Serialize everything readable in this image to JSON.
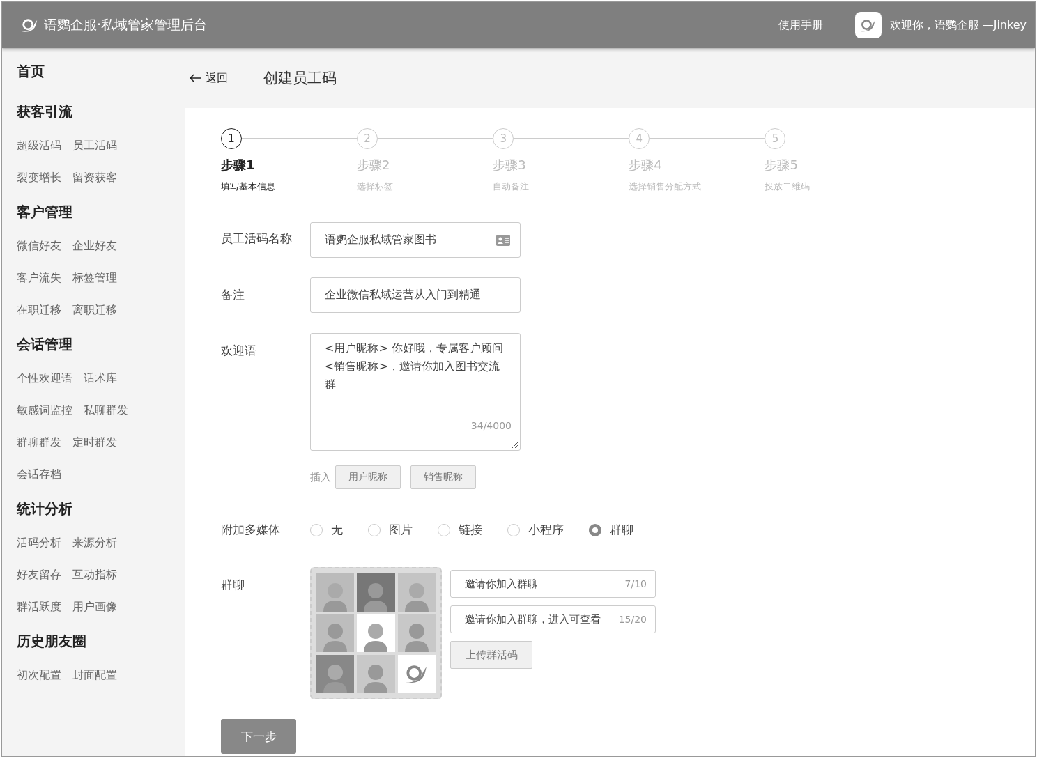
{
  "header": {
    "title": "语鹦企服·私域管家管理后台",
    "manual_link": "使用手册",
    "welcome": "欢迎你，语鹦企服 —Jinkey"
  },
  "sidebar": {
    "groups": [
      {
        "title": "首页"
      },
      {
        "title": "获客引流",
        "rows": [
          [
            "超级活码",
            "员工活码"
          ],
          [
            "裂变增长",
            "留资获客"
          ]
        ]
      },
      {
        "title": "客户管理",
        "rows": [
          [
            "微信好友",
            "企业好友"
          ],
          [
            "客户流失",
            "标签管理"
          ],
          [
            "在职迁移",
            "离职迁移"
          ]
        ]
      },
      {
        "title": "会话管理",
        "rows": [
          [
            "个性欢迎语",
            "话术库"
          ],
          [
            "敏感词监控",
            "私聊群发"
          ],
          [
            "群聊群发",
            "定时群发"
          ],
          [
            "会话存档"
          ]
        ]
      },
      {
        "title": "统计分析",
        "rows": [
          [
            "活码分析",
            "来源分析"
          ],
          [
            "好友留存",
            "互动指标"
          ],
          [
            "群活跃度",
            "用户画像"
          ]
        ]
      },
      {
        "title": "历史朋友圈",
        "rows": [
          [
            "初次配置",
            "封面配置"
          ]
        ]
      }
    ]
  },
  "page_header": {
    "back": "返回",
    "title": "创建员工码"
  },
  "steps": [
    {
      "number": "1",
      "title": "步骤1",
      "subtitle": "填写基本信息",
      "selected": true
    },
    {
      "number": "2",
      "title": "步骤2",
      "subtitle": "选择标签",
      "selected": false
    },
    {
      "number": "3",
      "title": "步骤3",
      "subtitle": "自动备注",
      "selected": false
    },
    {
      "number": "4",
      "title": "步骤4",
      "subtitle": "选择销售分配方式",
      "selected": false
    },
    {
      "number": "5",
      "title": "步骤5",
      "subtitle": "投放二维码",
      "selected": false
    }
  ],
  "form": {
    "name": {
      "label": "员工活码名称",
      "value": "语鹦企服私域管家图书"
    },
    "remark": {
      "label": "备注",
      "value": "企业微信私域运营从入门到精通"
    },
    "welcome": {
      "label": "欢迎语",
      "value": "<用户昵称>  你好哦，专属客户顾问<销售昵称>，邀请你加入图书交流群",
      "counter": "34/4000"
    },
    "insert": {
      "label": "插入",
      "buttons": [
        "用户昵称",
        "销售昵称"
      ]
    },
    "media": {
      "label": "附加多媒体",
      "options": [
        {
          "label": "无",
          "selected": false
        },
        {
          "label": "图片",
          "selected": false
        },
        {
          "label": "链接",
          "selected": false
        },
        {
          "label": "小程序",
          "selected": false
        },
        {
          "label": "群聊",
          "selected": true
        }
      ]
    },
    "group_chat": {
      "label": "群聊",
      "fields": [
        {
          "value": "邀请你加入群聊",
          "counter": "7/10"
        },
        {
          "value": "邀请你加入群聊，进入可查看",
          "counter": "15/20"
        }
      ],
      "upload": "上传群活码"
    }
  },
  "next_button": "下一步"
}
